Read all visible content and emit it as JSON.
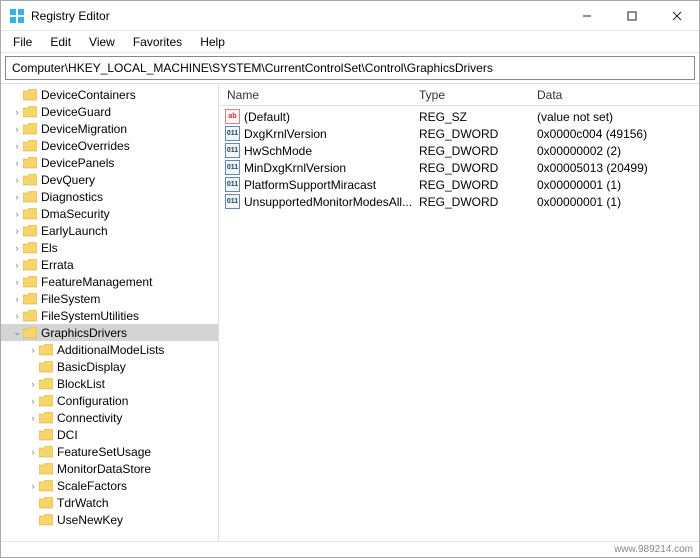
{
  "window": {
    "title": "Registry Editor"
  },
  "menu": {
    "file": "File",
    "edit": "Edit",
    "view": "View",
    "favorites": "Favorites",
    "help": "Help"
  },
  "address": "Computer\\HKEY_LOCAL_MACHINE\\SYSTEM\\CurrentControlSet\\Control\\GraphicsDrivers",
  "columns": {
    "name": "Name",
    "type": "Type",
    "data": "Data"
  },
  "tree": [
    {
      "label": "DeviceContainers",
      "exp": "",
      "child": false
    },
    {
      "label": "DeviceGuard",
      "exp": ">",
      "child": false
    },
    {
      "label": "DeviceMigration",
      "exp": ">",
      "child": false
    },
    {
      "label": "DeviceOverrides",
      "exp": ">",
      "child": false
    },
    {
      "label": "DevicePanels",
      "exp": ">",
      "child": false
    },
    {
      "label": "DevQuery",
      "exp": ">",
      "child": false
    },
    {
      "label": "Diagnostics",
      "exp": ">",
      "child": false
    },
    {
      "label": "DmaSecurity",
      "exp": ">",
      "child": false
    },
    {
      "label": "EarlyLaunch",
      "exp": ">",
      "child": false
    },
    {
      "label": "Els",
      "exp": ">",
      "child": false
    },
    {
      "label": "Errata",
      "exp": ">",
      "child": false
    },
    {
      "label": "FeatureManagement",
      "exp": ">",
      "child": false
    },
    {
      "label": "FileSystem",
      "exp": ">",
      "child": false
    },
    {
      "label": "FileSystemUtilities",
      "exp": ">",
      "child": false
    },
    {
      "label": "GraphicsDrivers",
      "exp": "v",
      "child": false,
      "selected": true
    },
    {
      "label": "AdditionalModeLists",
      "exp": ">",
      "child": true
    },
    {
      "label": "BasicDisplay",
      "exp": "",
      "child": true
    },
    {
      "label": "BlockList",
      "exp": ">",
      "child": true
    },
    {
      "label": "Configuration",
      "exp": ">",
      "child": true
    },
    {
      "label": "Connectivity",
      "exp": ">",
      "child": true
    },
    {
      "label": "DCI",
      "exp": "",
      "child": true
    },
    {
      "label": "FeatureSetUsage",
      "exp": ">",
      "child": true
    },
    {
      "label": "MonitorDataStore",
      "exp": "",
      "child": true
    },
    {
      "label": "ScaleFactors",
      "exp": ">",
      "child": true
    },
    {
      "label": "TdrWatch",
      "exp": "",
      "child": true
    },
    {
      "label": "UseNewKey",
      "exp": "",
      "child": true
    }
  ],
  "values": [
    {
      "name": "(Default)",
      "type": "REG_SZ",
      "data": "(value not set)",
      "kind": "sz"
    },
    {
      "name": "DxgKrnlVersion",
      "type": "REG_DWORD",
      "data": "0x0000c004 (49156)",
      "kind": "dword"
    },
    {
      "name": "HwSchMode",
      "type": "REG_DWORD",
      "data": "0x00000002 (2)",
      "kind": "dword"
    },
    {
      "name": "MinDxgKrnlVersion",
      "type": "REG_DWORD",
      "data": "0x00005013 (20499)",
      "kind": "dword"
    },
    {
      "name": "PlatformSupportMiracast",
      "type": "REG_DWORD",
      "data": "0x00000001 (1)",
      "kind": "dword"
    },
    {
      "name": "UnsupportedMonitorModesAll...",
      "type": "REG_DWORD",
      "data": "0x00000001 (1)",
      "kind": "dword"
    }
  ],
  "footer": "www.989214.com",
  "icon_text": {
    "sz": "ab",
    "dword": "011\n110"
  }
}
